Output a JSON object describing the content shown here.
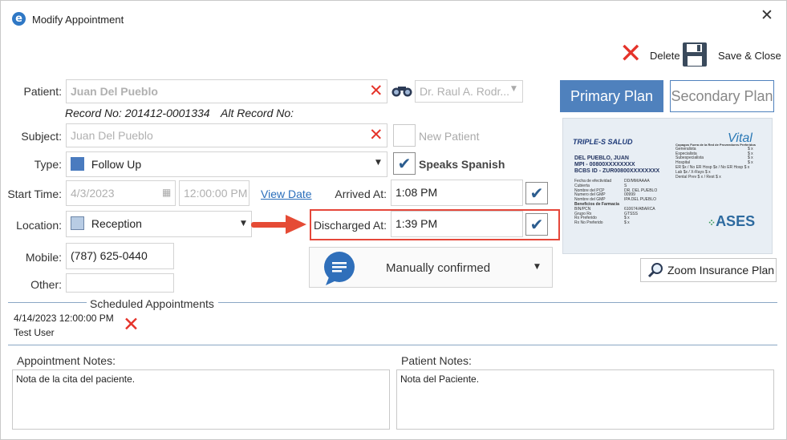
{
  "window": {
    "title": "Modify Appointment",
    "app_icon_letter": "e"
  },
  "toolbar": {
    "delete_label": "Delete",
    "save_close_label": "Save & Close"
  },
  "patient": {
    "label": "Patient:",
    "value": "Juan Del Pueblo",
    "record_no": "Record No: 201412-0001334",
    "alt_record_no": "Alt Record No:",
    "doctor": "Dr. Raul A. Rodr..."
  },
  "subject": {
    "label": "Subject:",
    "value": "Juan Del Pueblo"
  },
  "new_patient": {
    "label": "New Patient",
    "checked": false
  },
  "type": {
    "label": "Type:",
    "value": "Follow Up",
    "color": "#4a7bbf"
  },
  "speaks_spanish": {
    "label": "Speaks Spanish",
    "checked": true
  },
  "start_time": {
    "label": "Start Time:",
    "date": "4/3/2023",
    "time": "12:00:00 PM",
    "view_date_link": "View Date"
  },
  "arrived_at": {
    "label": "Arrived At:",
    "value": "1:08 PM",
    "checked": true
  },
  "location": {
    "label": "Location:",
    "value": "Reception",
    "color": "#b8cce4"
  },
  "discharged_at": {
    "label": "Discharged At:",
    "value": "1:39 PM",
    "checked": true
  },
  "mobile": {
    "label": "Mobile:",
    "value": "(787) 625-0440"
  },
  "other": {
    "label": "Other:",
    "value": ""
  },
  "confirmation": {
    "value": "Manually confirmed"
  },
  "plans": {
    "primary": "Primary Plan",
    "secondary": "Secondary Plan"
  },
  "insurance_card": {
    "brand_left": "TRIPLE-S SALUD",
    "brand_right": "Vital",
    "member_name": "DEL PUEBLO, JUAN",
    "mpi": "MPI - 00800XXXXXXXX",
    "bcbs_id": "BCBS ID - ZUR00800XXXXXXXX",
    "rows": [
      [
        "Fecha de efectividad",
        "DD/MM/AAAA"
      ],
      [
        "Cubierta",
        "S"
      ],
      [
        "Nombre del PCP",
        "DR. DEL PUEBLO"
      ],
      [
        "Numero del GMP",
        "00999"
      ],
      [
        "Nombre del GMP",
        "IPA DEL PUEBLO"
      ],
      [
        "Beneficios de Farmacia",
        ""
      ],
      [
        "BIN/PCN",
        "610674/ABARCA"
      ],
      [
        "Grupo Rx",
        "GTSSS"
      ],
      [
        "Rx Preferido",
        "$ x"
      ],
      [
        "Rx No Preferido",
        "$ x"
      ]
    ],
    "copay_title": "Copagos Fuera de la Red de Proveedores Preferidos",
    "copays": [
      [
        "Generalista",
        "$ x"
      ],
      [
        "Especialista",
        "$ x"
      ],
      [
        "Subespecialista",
        "$ x"
      ],
      [
        "Hospital",
        "$ x"
      ],
      [
        "ER $x / No ER Hosp $x / No ER Hosp $ x",
        ""
      ],
      [
        "Lab $x / X-Rays $ x",
        ""
      ],
      [
        "Dental Prev $ x / Rest $ x",
        ""
      ]
    ],
    "ases_logo": "ASES"
  },
  "zoom_button": "Zoom Insurance Plan",
  "scheduled": {
    "title": "Scheduled Appointments",
    "items": [
      {
        "datetime": "4/14/2023 12:00:00 PM",
        "user": "Test User"
      }
    ]
  },
  "notes": {
    "appointment_label": "Appointment Notes:",
    "appointment_text": "Nota de la cita del paciente.",
    "patient_label": "Patient Notes:",
    "patient_text": "Nota del Paciente."
  }
}
